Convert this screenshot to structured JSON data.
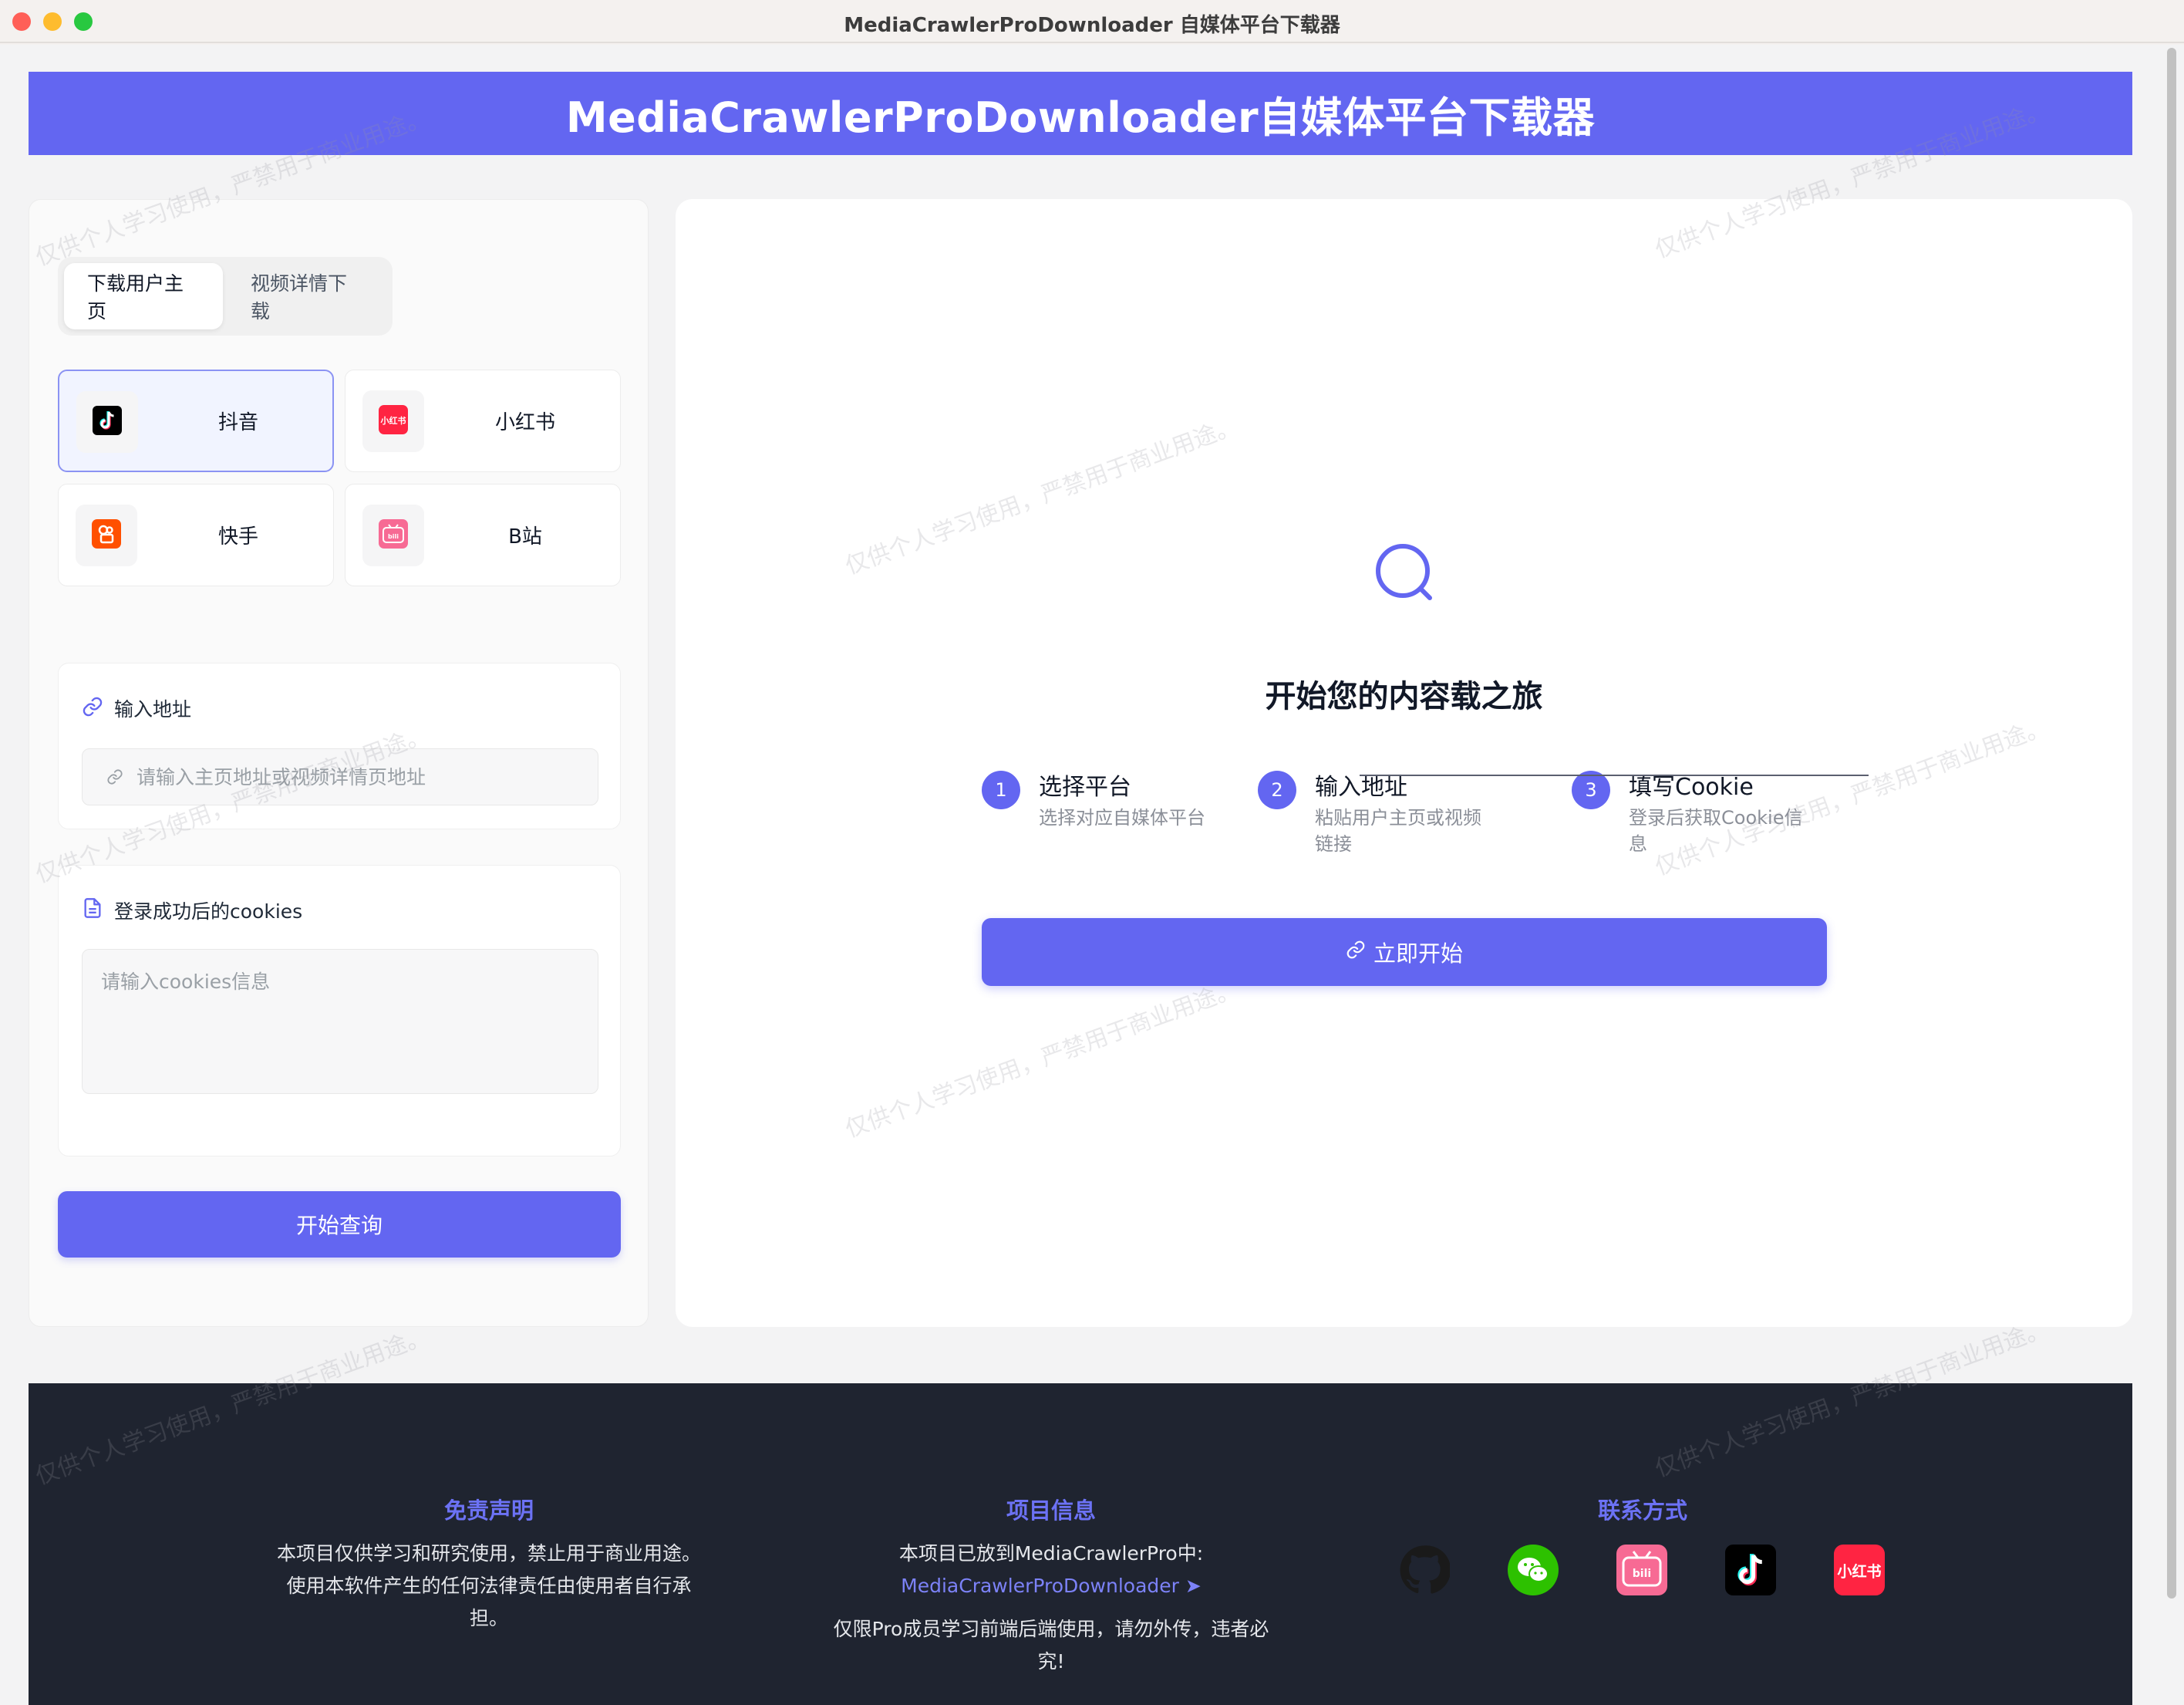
{
  "window": {
    "title": "MediaCrawlerProDownloader 自媒体平台下载器"
  },
  "banner": {
    "title": "MediaCrawlerProDownloader自媒体平台下载器"
  },
  "tabs": [
    {
      "label": "下载用户主页",
      "active": true
    },
    {
      "label": "视频详情下载",
      "active": false
    }
  ],
  "platforms": [
    {
      "label": "抖音",
      "icon": "douyin-icon",
      "selected": true
    },
    {
      "label": "小红书",
      "icon": "xiaohongshu-icon",
      "selected": false
    },
    {
      "label": "快手",
      "icon": "kuaishou-icon",
      "selected": false
    },
    {
      "label": "B站",
      "icon": "bilibili-icon",
      "selected": false
    }
  ],
  "url_card": {
    "title": "输入地址",
    "placeholder": "请输入主页地址或视频详情页地址",
    "value": ""
  },
  "cookie_card": {
    "title": "登录成功后的cookies",
    "placeholder": "请输入cookies信息",
    "value": ""
  },
  "query_button": {
    "label": "开始查询"
  },
  "main": {
    "heading": "开始您的内容载之旅",
    "steps": [
      {
        "num": "1",
        "title": "选择平台",
        "desc": "选择对应自媒体平台"
      },
      {
        "num": "2",
        "title": "输入地址",
        "desc": "粘贴用户主页或视频链接"
      },
      {
        "num": "3",
        "title": "填写Cookie",
        "desc": "登录后获取Cookie信息"
      }
    ],
    "start_button": {
      "label": "立即开始"
    }
  },
  "footer": {
    "disclaimer": {
      "heading": "免责声明",
      "lines": [
        "本项目仅供学习和研究使用，禁止用于商业用途。",
        "使用本软件产生的任何法律责任由使用者自行承",
        "担。"
      ]
    },
    "project": {
      "heading": "项目信息",
      "line1": "本项目已放到MediaCrawlerPro中:",
      "link": "MediaCrawlerProDownloader",
      "note_lines": [
        "仅限Pro成员学习前端后端使用，请勿外传，违者必",
        "究!"
      ]
    },
    "contact": {
      "heading": "联系方式",
      "icons": [
        "github-icon",
        "wechat-icon",
        "bilibili-icon",
        "douyin-icon",
        "xiaohongshu-icon"
      ]
    }
  },
  "watermark": {
    "text": "仅供个人学习使用，严禁用于商业用途。"
  },
  "colors": {
    "accent": "#6366f1",
    "footer_bg": "#1f2430",
    "footer_heading": "#6c72f5"
  }
}
